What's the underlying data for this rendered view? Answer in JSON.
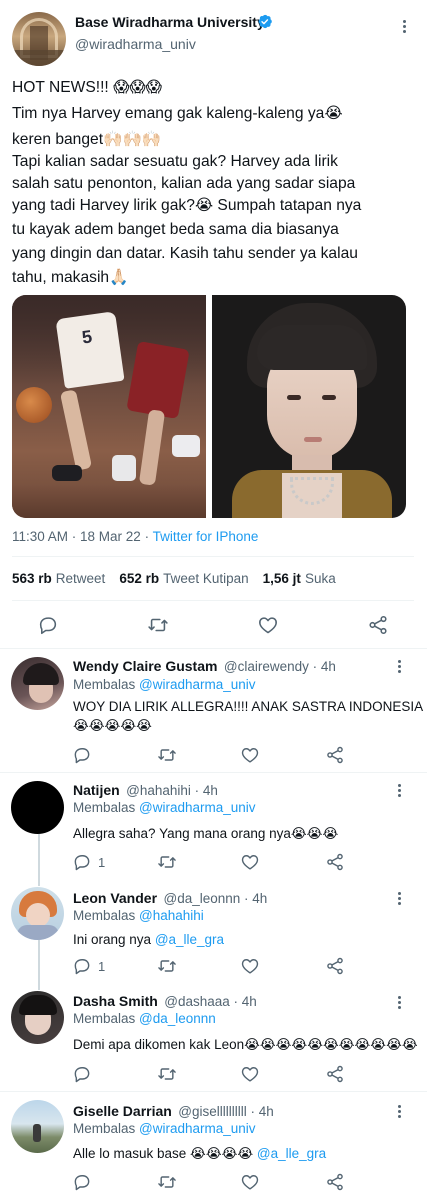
{
  "main_tweet": {
    "author_name": "Base Wiradharma University",
    "author_handle": "@wiradharma_univ",
    "text_lines": [
      "HOT NEWS!!! 😱😱😱",
      "Tim nya Harvey emang gak kaleng-kaleng ya😭",
      "keren banget🙌🏻🙌🏻🙌🏻",
      "Tapi kalian sadar sesuatu gak? Harvey ada lirik",
      "salah satu penonton, kalian ada yang sadar siapa",
      "yang tadi Harvey lirik gak?😭 Sumpah tatapan nya",
      "tu kayak adem banget beda sama dia biasanya",
      "yang dingin dan datar. Kasih tahu sender ya kalau",
      "tahu, makasih🙏🏻"
    ],
    "time": "11:30 AM · 18 Mar 22 · ",
    "source": "Twitter for IPhone",
    "stats": {
      "retweets_count": "563 rb",
      "retweets_label": "Retweet",
      "quotes_count": "652 rb",
      "quotes_label": "Tweet Kutipan",
      "likes_count": "1,56 jt",
      "likes_label": "Suka"
    }
  },
  "replies": [
    {
      "name": "Wendy Claire Gustam",
      "handle": "@clairewendy · 4h",
      "replying_label": "Membalas ",
      "replying_to": "@wiradharma_univ",
      "text_lines": [
        "WOY DIA LIRIK ALLEGRA!!!! ANAK SASTRA INDONESIA",
        "😭😭😭😭😭"
      ],
      "reply_count": ""
    },
    {
      "name": "Natijen",
      "handle": "@hahahihi · 4h",
      "replying_label": "Membalas ",
      "replying_to": "@wiradharma_univ",
      "text_lines": [
        "Allegra saha? Yang mana orang nya😭😭😭"
      ],
      "reply_count": "1"
    },
    {
      "name": "Leon Vander",
      "handle": "@da_leonnn · 4h",
      "replying_label": "Membalas ",
      "replying_to": "@hahahihi",
      "text_lines": [
        "Ini orang nya "
      ],
      "mention": "@a_lle_gra",
      "reply_count": "1"
    },
    {
      "name": "Dasha Smith",
      "handle": "@dashaaa · 4h",
      "replying_label": "Membalas ",
      "replying_to": "@da_leonnn",
      "text_lines": [
        "Demi apa dikomen kak Leon😭😭😭😭😭😭😭😭😭😭😭"
      ],
      "reply_count": ""
    },
    {
      "name": "Giselle Darrian",
      "handle": "@gisellllllllll · 4h",
      "replying_label": "Membalas ",
      "replying_to": "@wiradharma_univ",
      "text_lines": [
        "Alle lo masuk base 😭😭😭😭 "
      ],
      "mention": "@a_lle_gra",
      "reply_count": ""
    }
  ],
  "icons": {
    "verified": "verified-badge-icon",
    "reply": "reply-icon",
    "retweet": "retweet-icon",
    "like": "heart-icon",
    "share": "share-icon",
    "more": "more-options-icon"
  },
  "colors": {
    "accent": "#1d9bf0",
    "text": "#0f1419",
    "secondary": "#536471",
    "divider": "#eff3f4"
  }
}
